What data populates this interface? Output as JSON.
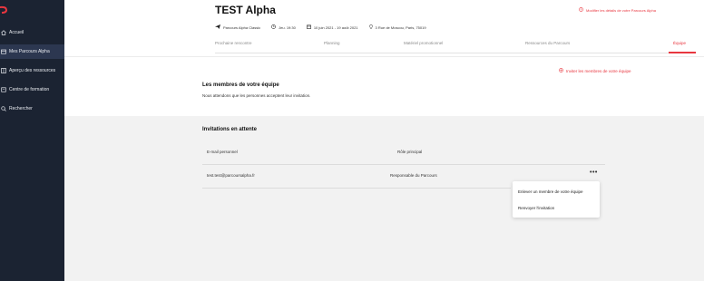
{
  "colors": {
    "sidebar_bg": "#1b2332",
    "sidebar_active": "#2c3750",
    "accent": "#e8363f",
    "page_bg": "#f2f2f2"
  },
  "sidebar": {
    "items": [
      {
        "label": "Accueil",
        "icon": "home-icon"
      },
      {
        "label": "Mes Parcours Alpha",
        "icon": "folder-icon",
        "active": true
      },
      {
        "label": "Aperçu des ressources",
        "icon": "grid-icon"
      },
      {
        "label": "Centre de formation",
        "icon": "book-icon"
      },
      {
        "label": "Rechercher",
        "icon": "search-icon"
      }
    ]
  },
  "header": {
    "title": "TEST Alpha",
    "modify_link": "Modifier les détails de votre Parcours Alpha",
    "meta": {
      "type": "Parcours Alpha Classic",
      "time": "Jeu. 19:30",
      "dates": "10 juin 2021 - 19 août 2021",
      "location": "3 Rue de Moscou, Paris, 75019"
    },
    "tabs": [
      {
        "label": "Prochaine rencontre"
      },
      {
        "label": "Planning"
      },
      {
        "label": "Matériel promotionnel"
      },
      {
        "label": "Ressources du Parcours"
      },
      {
        "label": "Équipe",
        "active": true
      }
    ]
  },
  "team": {
    "invite_link": "Inviter les membres de votre équipe",
    "title": "Les membres de votre équipe",
    "subtitle": "Nous attendons que les personnes acceptent leur invitation."
  },
  "invitations": {
    "title": "Invitations en attente",
    "columns": [
      "E-mail personnel",
      "Rôle principal"
    ],
    "rows": [
      {
        "email": "test.test@parcoursalpha.fr",
        "role": "Responsable du Parcours",
        "more": "•••"
      }
    ]
  },
  "menu": {
    "items": [
      "Enlever un membre de votre équipe",
      "Renvoyer l'invitation"
    ]
  }
}
